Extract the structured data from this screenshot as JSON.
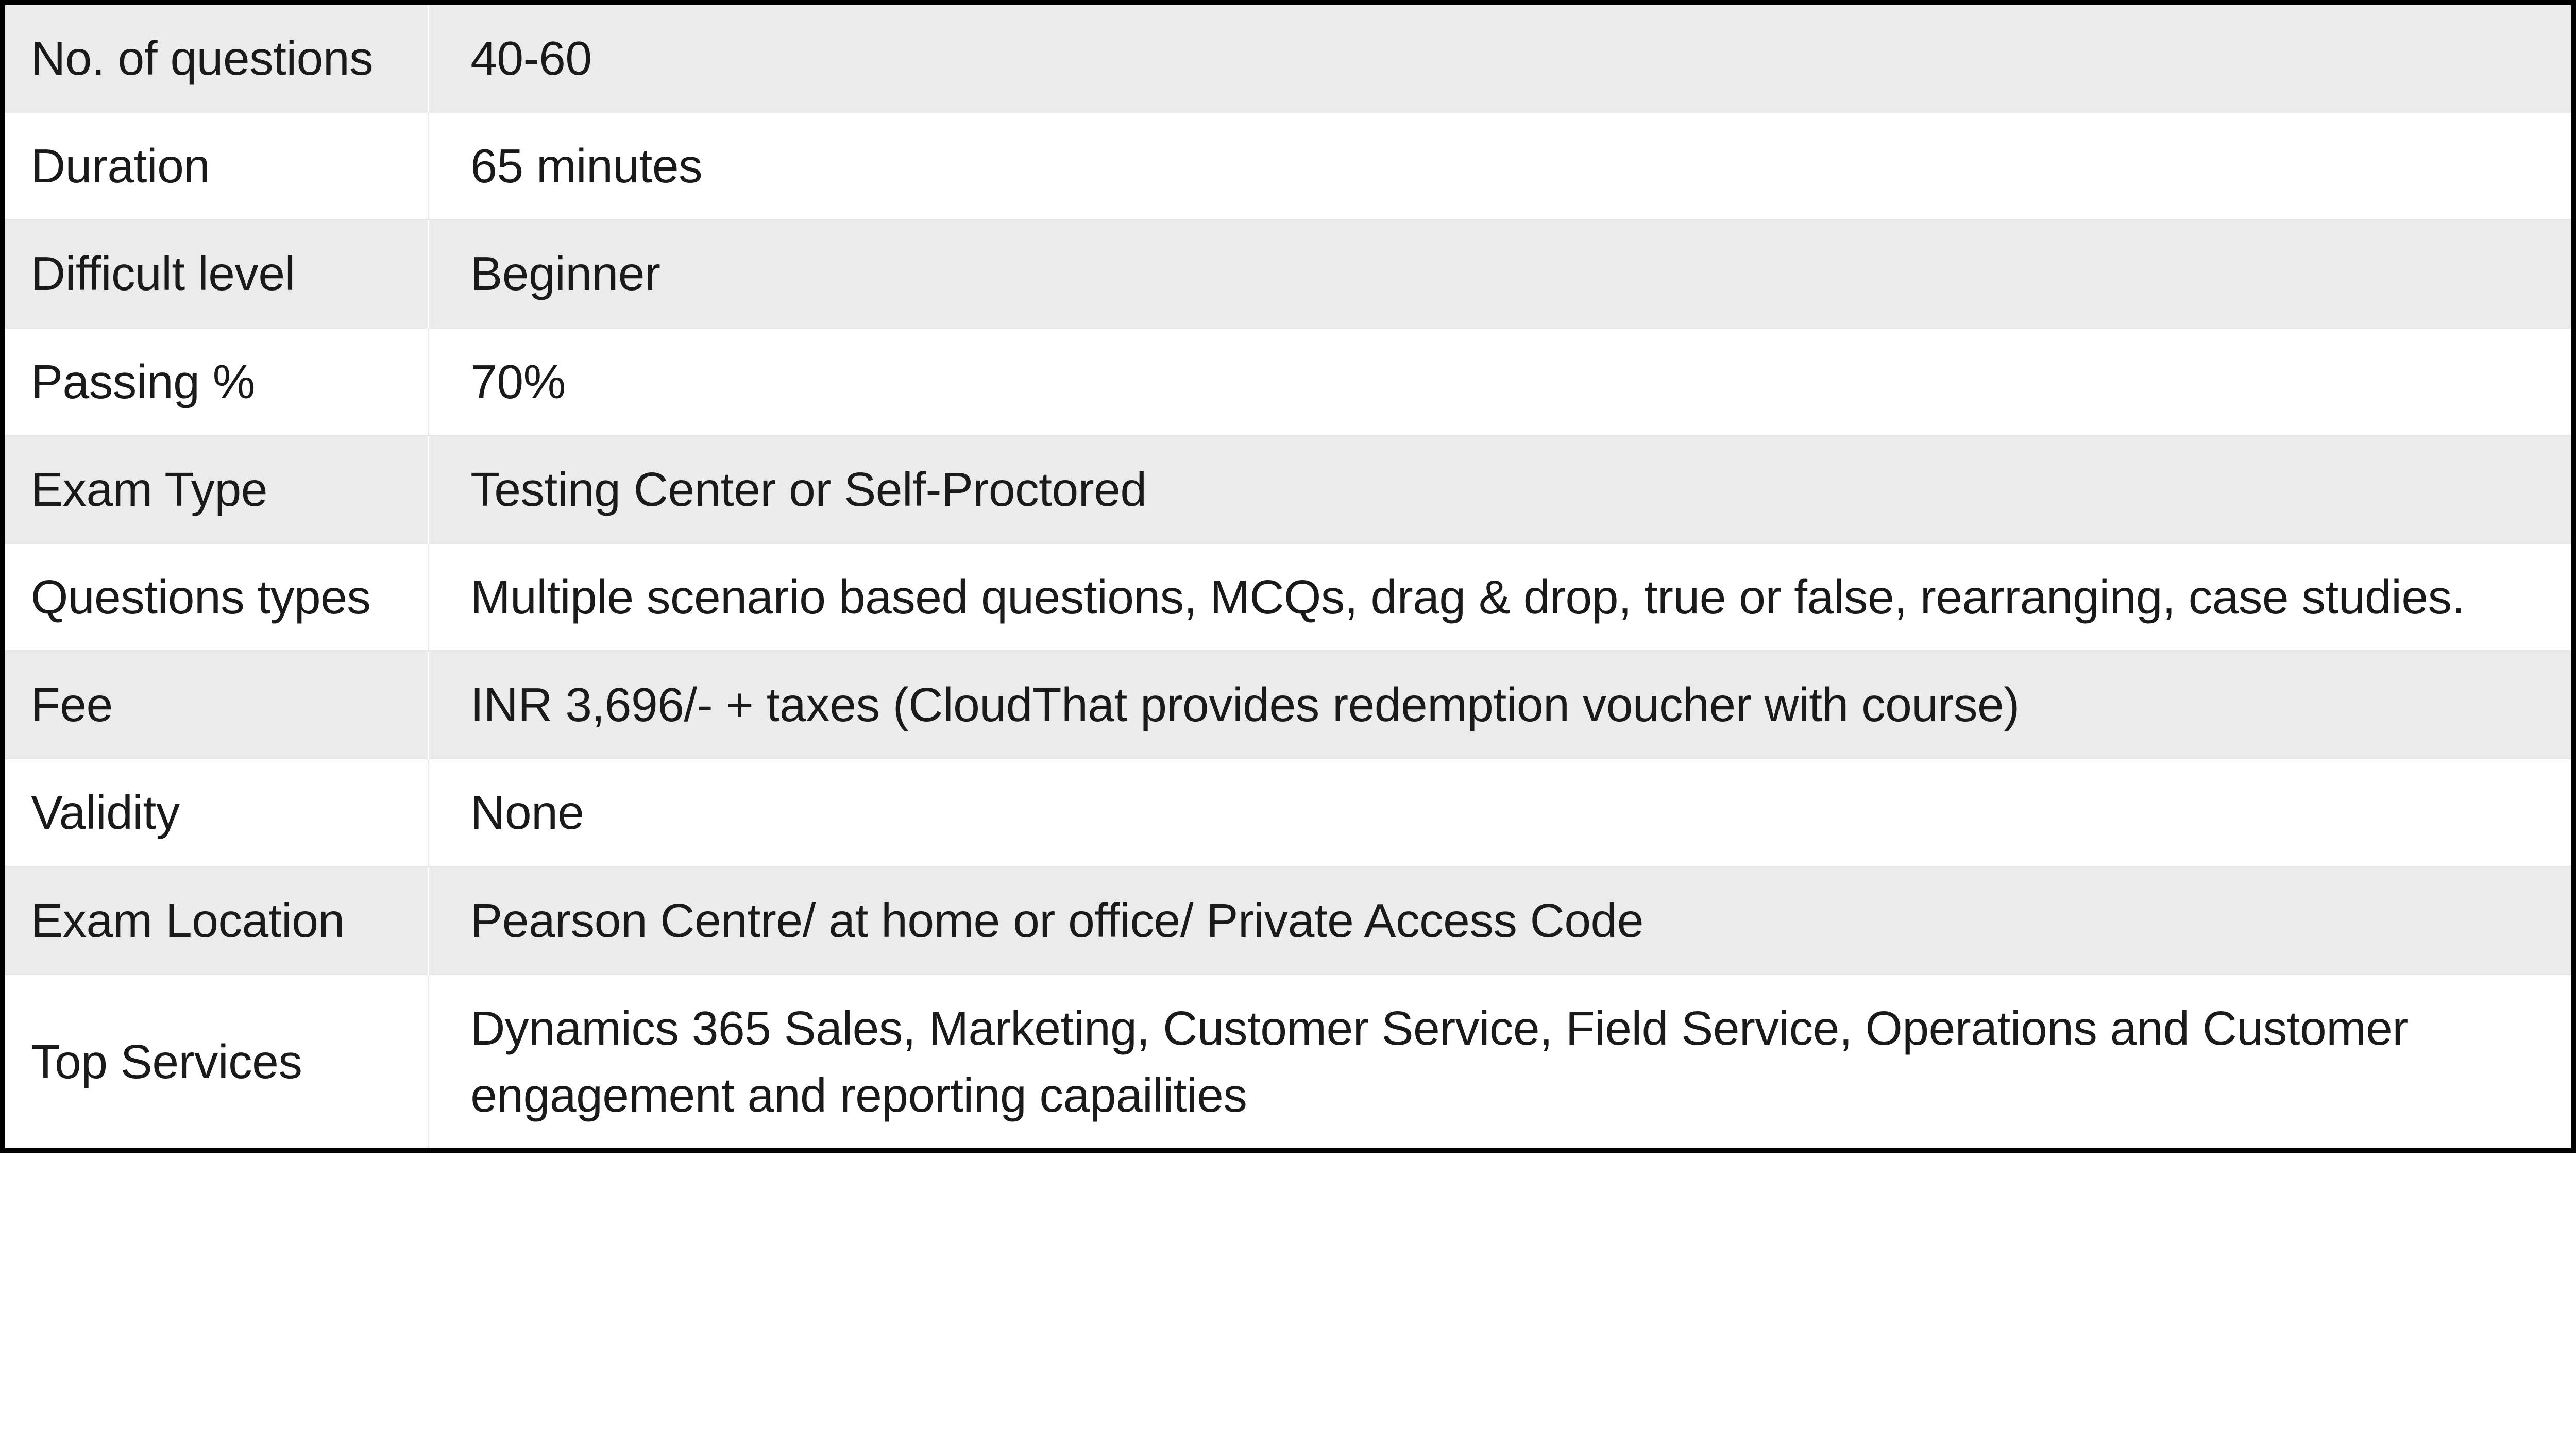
{
  "rows": [
    {
      "label": "No. of questions",
      "value": "40-60"
    },
    {
      "label": "Duration",
      "value": "65 minutes"
    },
    {
      "label": "Difficult level",
      "value": "Beginner"
    },
    {
      "label": "Passing %",
      "value": "70%"
    },
    {
      "label": "Exam Type",
      "value": "Testing Center or Self-Proctored"
    },
    {
      "label": "Questions types",
      "value": "Multiple scenario based questions, MCQs, drag & drop, true or false, rearranging, case studies."
    },
    {
      "label": "Fee",
      "value": "INR 3,696/- + taxes (CloudThat provides redemption voucher with course)"
    },
    {
      "label": "Validity",
      "value": "None"
    },
    {
      "label": "Exam Location",
      "value": "Pearson Centre/ at home or office/ Private Access Code"
    },
    {
      "label": "Top Services",
      "value": "Dynamics 365 Sales, Marketing, Customer Service, Field Service, Operations and Customer engagement and reporting capailities"
    }
  ]
}
